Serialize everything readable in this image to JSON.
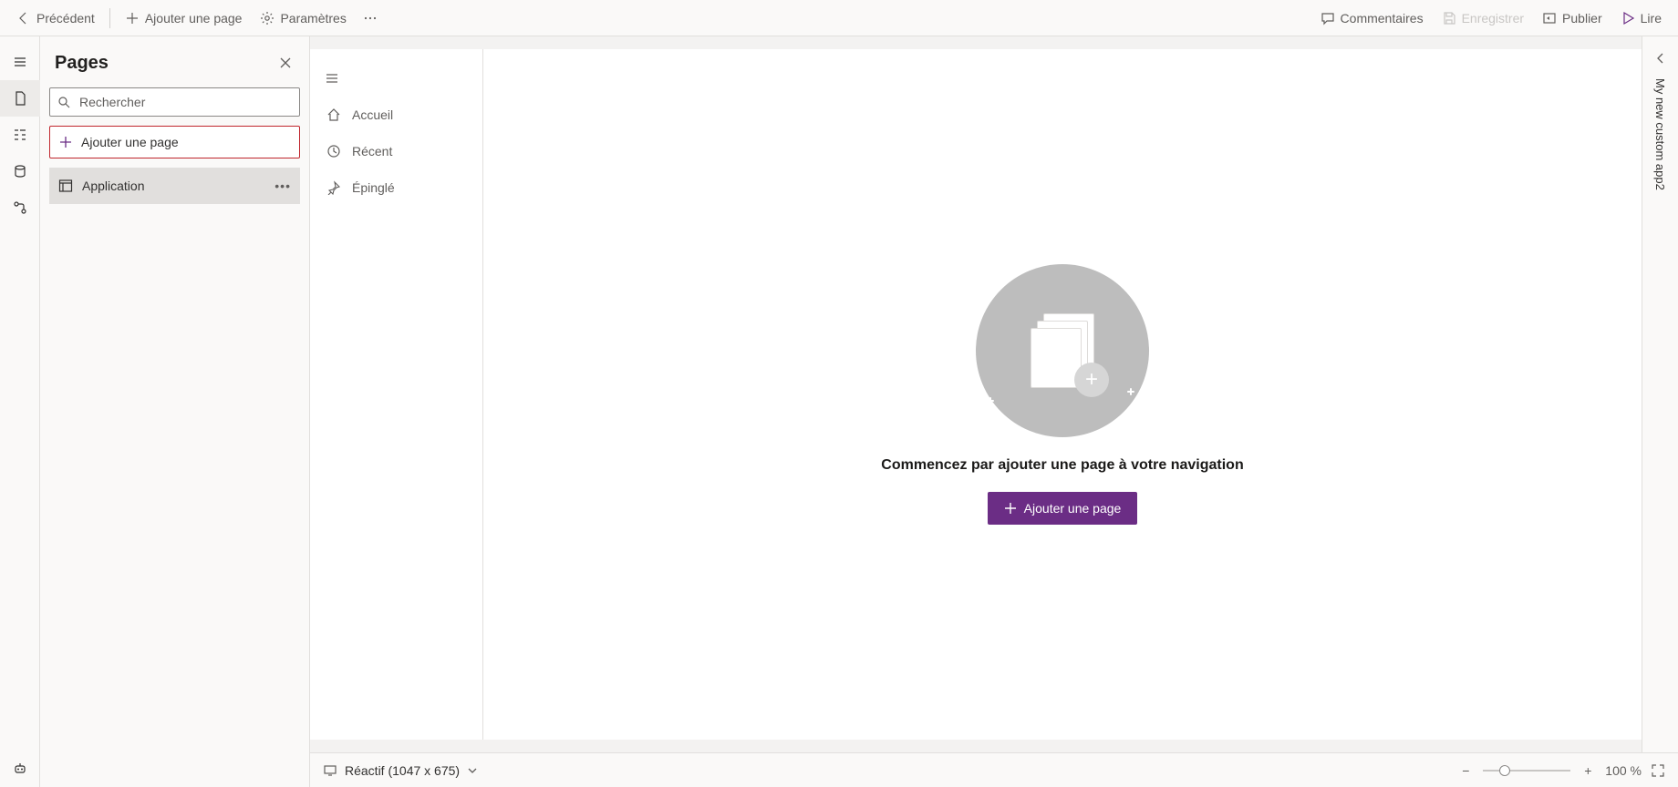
{
  "toolbar": {
    "back": "Précédent",
    "add_page": "Ajouter une page",
    "settings": "Paramètres",
    "comments": "Commentaires",
    "save": "Enregistrer",
    "publish": "Publier",
    "play": "Lire"
  },
  "panel": {
    "title": "Pages",
    "search_placeholder": "Rechercher",
    "add_page_label": "Ajouter une page",
    "items": [
      {
        "label": "Application"
      }
    ]
  },
  "inner_nav": {
    "items": [
      {
        "label": "Accueil"
      },
      {
        "label": "Récent"
      },
      {
        "label": "Épinglé"
      }
    ]
  },
  "empty_state": {
    "headline": "Commencez par ajouter une page à votre navigation",
    "cta": "Ajouter une page"
  },
  "right_panel": {
    "app_name": "My new custom app2"
  },
  "statusbar": {
    "responsive_label": "Réactif (1047 x 675)",
    "zoom_label": "100 %"
  }
}
